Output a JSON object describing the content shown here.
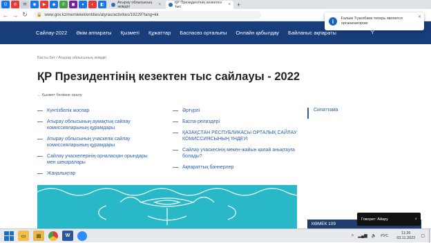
{
  "browser": {
    "tabs": [
      {
        "title": "Атырау облысының әкімдігі",
        "active": false
      },
      {
        "title": "ҚР Президентінің кезектен тыс",
        "active": true
      }
    ],
    "new_tab": "+",
    "url": "www.gov.kz/memleket/entities/atyrau/activities/19229?lang=kk",
    "nav": {
      "back": "←",
      "forward": "→",
      "reload": "↻"
    }
  },
  "site_nav": {
    "items": [
      "Сайлау-2022",
      "Әкім аппараты",
      "Қызметі",
      "Құжаттар",
      "Баспасөз орталығы",
      "Онлайн қабылдау",
      "Байланыс ақпараты"
    ]
  },
  "notification": {
    "text": "Ғалым Түзелбаев теперь является организатором"
  },
  "breadcrumb": "Басты бет  /  Атырау облысының әкімдігі",
  "page_title": "ҚР Президентінің кезектен тыс сайлауы - 2022",
  "back_link": "←  Қызмет бөлімне оралу",
  "left_links": [
    "Күнтізбелік жоспар",
    "Атырау облысының аумақтық сайлау комиссияларының құрамдары",
    "Атырау облысының учаскелік сайлау комиссияларының құрамдары",
    "Сайлау учаскелерінің орналасқан орындары мен шекаралары",
    "Жаңалықтар"
  ],
  "mid_links": [
    "Әртүрлі",
    "Баспа-релиздері",
    "ҚАЗАҚСТАН РЕСПУБЛИКАСЫ ОРТАЛЫҚ САЙЛАУ КОМИССИЯСЫНЫҢ ҮНДЕУІ",
    "Сайлау учаскесінің мекен-жайын қалай анықтауға болады?",
    "Ақпараттық баннерлер"
  ],
  "sidebar_link": "Сипаттама",
  "chat_label": "КӨМЕК 109",
  "toast": {
    "text": "Говорит: Айару",
    "close": "×"
  },
  "taskbar": {
    "language": "РУС",
    "time": "11:26",
    "date": "03.11.2022"
  },
  "colors": {
    "nav_bg": "#173d7a",
    "link": "#2a5db0",
    "banner": "#29b8c7"
  }
}
